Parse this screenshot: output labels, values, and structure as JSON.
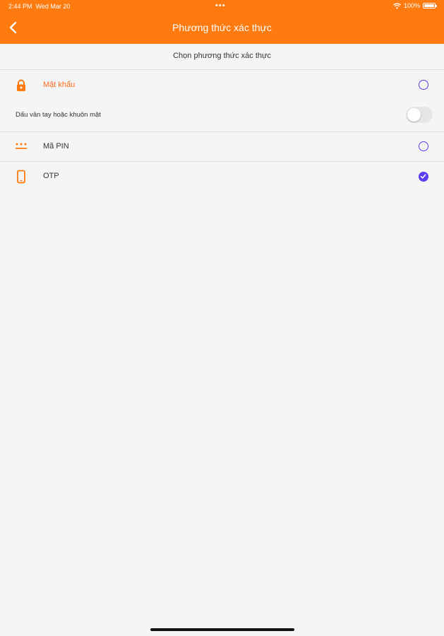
{
  "status_bar": {
    "time": "2:44 PM",
    "date": "Wed Mar 20",
    "dots": "•••",
    "battery": "100%"
  },
  "header": {
    "title": "Phương thức xác thực",
    "back_icon": "chevron-left-icon",
    "background": "#ff7a0f"
  },
  "subheader": {
    "text": "Chọn phương thức xác thực"
  },
  "options": [
    {
      "label": "Mật khẩu",
      "icon": "lock-icon",
      "selected": false,
      "highlight": true
    },
    {
      "label": "Mã PIN",
      "icon": "pin-dots-icon",
      "selected": false
    },
    {
      "label": "OTP",
      "icon": "phone-icon",
      "selected": true
    }
  ],
  "biometric": {
    "label": "Dấu vân tay hoặc khuôn mặt",
    "enabled": false
  },
  "colors": {
    "accent": "#ff7a0f",
    "radio": "#5b3ef0",
    "highlight_text": "#ff6a1a"
  }
}
